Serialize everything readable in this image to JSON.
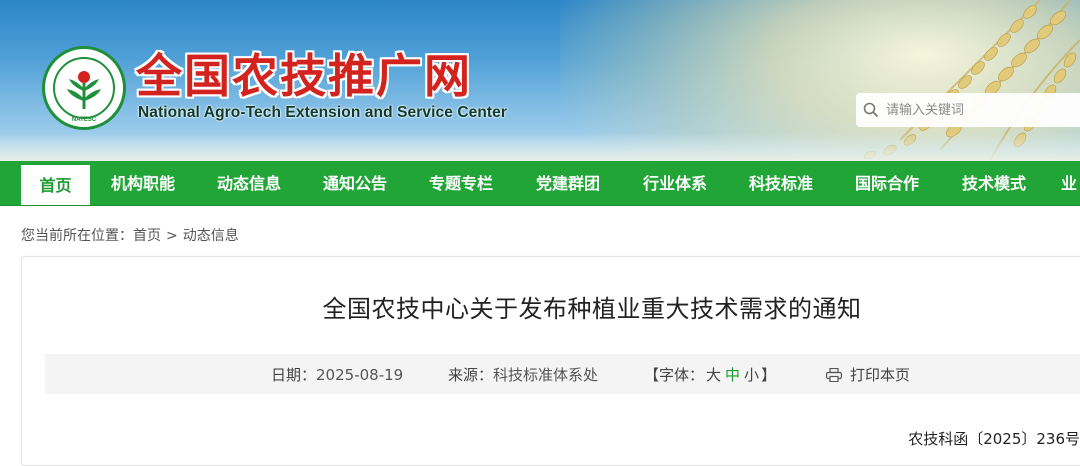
{
  "header": {
    "site_title": "全国农技推广网",
    "site_subtitle": "National Agro-Tech Extension and Service Center",
    "logo_ring_text": "NATESC",
    "search": {
      "placeholder": "请输入关键词",
      "value": ""
    }
  },
  "nav": {
    "items": [
      {
        "label": "首页",
        "active": true
      },
      {
        "label": "机构职能"
      },
      {
        "label": "动态信息"
      },
      {
        "label": "通知公告"
      },
      {
        "label": "专题专栏"
      },
      {
        "label": "党建群团"
      },
      {
        "label": "行业体系"
      },
      {
        "label": "科技标准"
      },
      {
        "label": "国际合作"
      },
      {
        "label": "技术模式"
      },
      {
        "label": "业"
      }
    ]
  },
  "breadcrumb": {
    "prefix": "您当前所在位置：",
    "items": [
      "首页",
      "动态信息"
    ],
    "separator": ">"
  },
  "article": {
    "title": "全国农技中心关于发布种植业重大技术需求的通知",
    "date_label": "日期：",
    "date": "2025-08-19",
    "source_label": "来源：",
    "source": "科技标准体系处",
    "font_label": "【字体：",
    "font_large": "大",
    "font_medium": "中",
    "font_small": "小",
    "font_close": "】",
    "print_label": "打印本页",
    "doc_number": "农技科函〔2025〕236号"
  },
  "colors": {
    "nav_green": "#22a537",
    "title_red": "#d2231f",
    "active_font": "#1f9a32"
  }
}
